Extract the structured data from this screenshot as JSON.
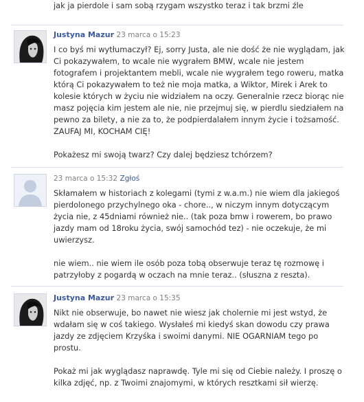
{
  "top_fragment": "jak ja pierdole i sam sobą rzygam wszystko teraz i tak brzmi źle",
  "posts": [
    {
      "author": "Justyna Mazur",
      "timestamp": "23 marca o 15:23",
      "report_label": "",
      "paragraphs": [
        "I co byś mi wytłumaczył? Ej, sorry Justa, ale nie dość że nie wyglądam, jak Ci pokazywałem, to wcale nie wygrałem BMW, wcale nie jestem fotografem i projektantem mebli, wcale nie wygrałem tego roweru, matka którą Ci pokazywałem to też nie moja matka, a Wiktor, Mirek i Arek to kolesie których w życiu nie widziałem na oczy. Generalnie rzecz biorąc nie masz pojęcia kim jestem ale nie, nie przejmuj się, w pierdlu siedziałem na pewno za bilety, a nie za to, że podpierdalałem innym życie i tożsamość. ZAUFAJ MI, KOCHAM CIĘ!",
        "Pokażesz mi swoją twarz? Czy dalej będziesz tchórzem?"
      ]
    },
    {
      "author": "",
      "timestamp": "23 marca o 15:32",
      "report_label": "Zgłoś",
      "paragraphs": [
        "Skłamałem w historiach z kolegami (tymi z w.a.m.) nie wiem dla jakiegoś pierdolonego przychylnego oka - chore.., w niczym innym dotyczącym życia nie, z 45dniami również nie.. (tak poza bmw i rowerem, bo prawo jazdy mam od 18roku życia, swój samochód tez) - nie oczekuje, że mi uwierzysz.",
        "nie wiem.. nie wiem ile osób poza tobą obserwuje teraz tę rozmowę i patrzyłoby z pogardą w oczach na mnie teraz.. (słuszna z reszta)."
      ]
    },
    {
      "author": "Justyna Mazur",
      "timestamp": "23 marca o 15:35",
      "report_label": "",
      "paragraphs": [
        "Nikt nie obserwuje, bo nawet nie wiesz jak cholernie mi jest wstyd, że wdałam się w coś takiego. Wysłałeś mi kiedyś skan dowodu czy prawa jazdy ze zdjęciem Krzyśka i swoimi danymi. NIE OGARNIAM tego po prostu.",
        "Pokaż mi jak wyglądasz naprawdę. Tyle mi się od Ciebie należy. I proszę o kilka zdjęć, np. z Twoimi znajomymi, w których resztkami sił wierzę."
      ]
    }
  ],
  "colors": {
    "link": "#3b5998",
    "timestamp": "#808080",
    "separator": "#d8dfea",
    "text": "#333333"
  },
  "icons": [
    "user-photo-avatar",
    "default-silhouette-avatar"
  ]
}
